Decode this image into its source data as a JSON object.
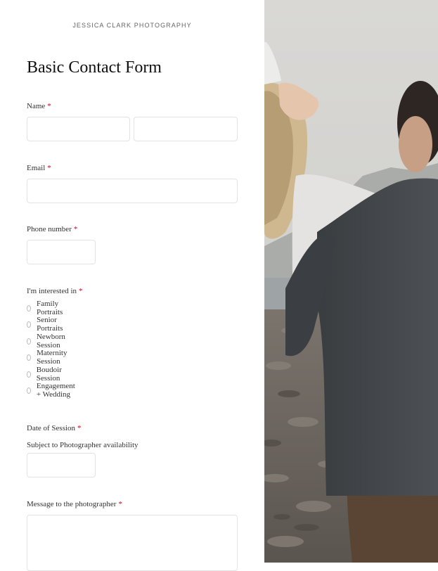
{
  "brand": "JESSICA CLARK PHOTOGRAPHY",
  "form": {
    "title": "Basic Contact Form",
    "required_mark": "*",
    "name_label": "Name",
    "email_label": "Email",
    "phone_label": "Phone number",
    "interest_label": "I'm interested in",
    "interest_options": [
      "Family Portraits",
      "Senior Portraits",
      "Newborn Session",
      "Maternity Session",
      "Boudoir Session",
      "Engagement + Wedding"
    ],
    "date_label": "Date of Session",
    "date_sublabel": "Subject to Photographer availability",
    "message_label": "Message to the photographer"
  },
  "photo": {
    "subject": "couple-embracing-on-rocky-shore"
  }
}
